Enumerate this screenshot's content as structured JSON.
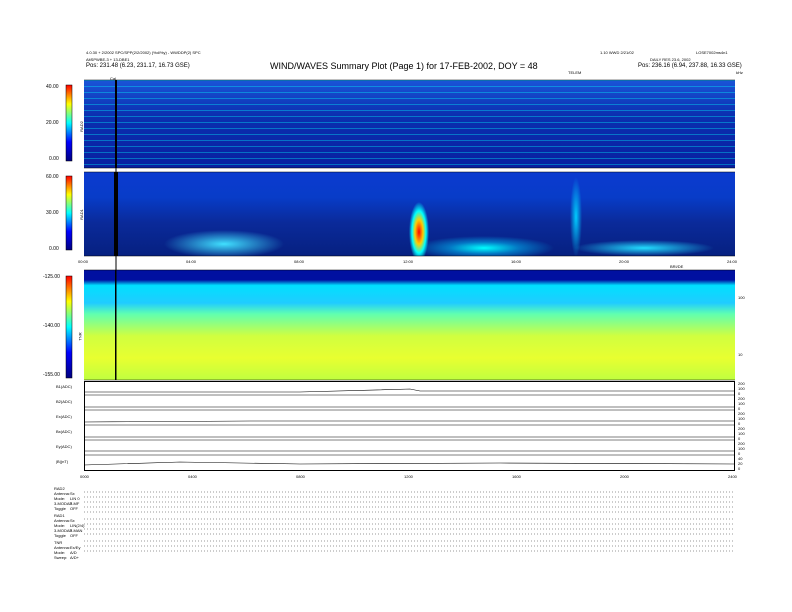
{
  "header": {
    "title": "WIND/WAVES Summary Plot (Page 1) for 17-FEB-2002, DOY = 48",
    "left_line1": "4.0.30 + 2/2002 SPC/SPP(2/2/2002) (%d/%y) - WWDDP(2) SPC",
    "left_line2": "AltSPWBE-3 + 13-DBE1",
    "left_line3": "Pos: 231.48 (6.23, 231.17, 16.73 GSE)",
    "right_line1": "1.10 WWD 2/21/02",
    "right_line2": "LOSE7002ms4n1",
    "right_line3": "DAILY RES 23.6, 2002",
    "right_line4": "Pos: 236.16 (6.94, 237.88, 16.33 GSE)",
    "right_unit": "kHz",
    "top_marker": "Cal",
    "right_marker": "TELEM",
    "tnr_marker": "BRI/DE"
  },
  "panels": [
    {
      "id": "RAD2",
      "label": "RAD2",
      "ticks": [
        "40.00",
        "20.00",
        "0.00"
      ]
    },
    {
      "id": "RAD1",
      "label": "RAD1",
      "ticks": [
        "60.00",
        "30.00",
        "0.00"
      ]
    },
    {
      "id": "TNR",
      "label": "TNR",
      "ticks": [
        "-125.00",
        "-140.00",
        "-155.00"
      ]
    }
  ],
  "time_ticks": [
    "00:00",
    "04:00",
    "08:00",
    "12:00",
    "16:00",
    "20:00",
    "24:00"
  ],
  "time_ticks_bottom": [
    "0000",
    "0400",
    "0800",
    "1200",
    "1600",
    "2000",
    "2400"
  ],
  "tnr_right_ticks": [
    "100",
    "10"
  ],
  "lineplots": [
    {
      "label": "B1(ADC)",
      "ticks": [
        "200",
        "100",
        "0"
      ]
    },
    {
      "label": "B2(ADC)",
      "ticks": [
        "200",
        "100",
        "0"
      ]
    },
    {
      "label": "Ex(ADC)",
      "ticks": [
        "200",
        "100",
        "0"
      ]
    },
    {
      "label": "Bx(ADC)",
      "ticks": [
        "200",
        "100",
        "0"
      ]
    },
    {
      "label": "Ey(ADC)",
      "ticks": [
        "200",
        "100",
        "0"
      ]
    },
    {
      "label": "|B|(nT)",
      "ticks": [
        "40",
        "20",
        "0"
      ]
    }
  ],
  "bottom_info": [
    {
      "k": "RAD2",
      "v": ""
    },
    {
      "k": "Antenna:",
      "v": "Sx"
    },
    {
      "k": "Mode:",
      "v": "LIN 0"
    },
    {
      "k": "3-MODAP",
      "v": "3-MF"
    },
    {
      "k": "Toggle",
      "v": "OFF"
    },
    {
      "k": "RAD1",
      "v": ""
    },
    {
      "k": "Antenna:",
      "v": "Sx"
    },
    {
      "k": "Mode:",
      "v": "LIN(2/4)"
    },
    {
      "k": "3-MODAP",
      "v": "3-MAN"
    },
    {
      "k": "Toggle",
      "v": "OFF"
    },
    {
      "k": "TNR",
      "v": ""
    },
    {
      "k": "Antenna:",
      "v": "Ex/Ey"
    },
    {
      "k": "Mode:",
      "v": "A/D"
    },
    {
      "k": "Sweep:",
      "v": "A/D+"
    }
  ],
  "chart_data": {
    "type": "heatmap",
    "title": "WIND/WAVES Summary Plot (Page 1) for 17-FEB-2002, DOY = 48",
    "x_range_hours": [
      0,
      24
    ],
    "colormap": [
      "#00007f",
      "#0000ff",
      "#00ffff",
      "#ffff00",
      "#ff0000"
    ],
    "events": [
      {
        "panel": "RAD1",
        "start_hour": 12.1,
        "peak_hour": 12.3,
        "type": "type III burst"
      },
      {
        "panel": "RAD1",
        "start_hour": 17.7,
        "peak_hour": 17.9,
        "type": "type III burst"
      }
    ],
    "grid": false
  }
}
